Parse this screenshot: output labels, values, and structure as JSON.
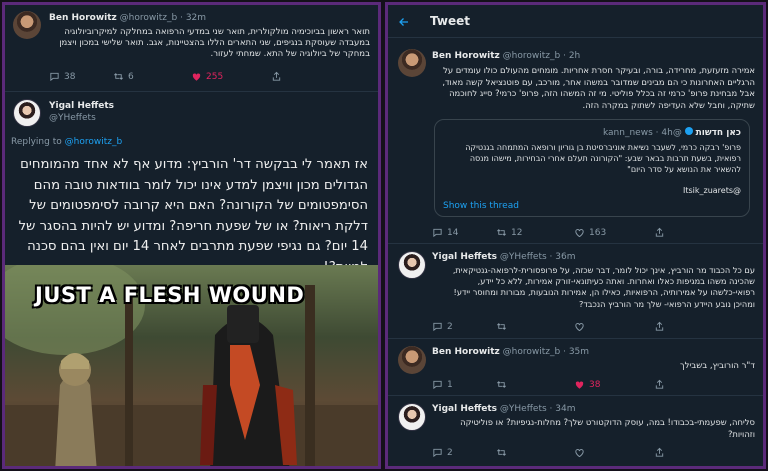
{
  "left": {
    "tweet1": {
      "name": "Ben Horowitz",
      "handle": "@horowitz_b",
      "time": "32m",
      "text": "תואר ראשון בביוכימיה מולקולרית, תואר שני במדעי הרפואה במחלקה למיקרוביולוגיה במעבדה שעוסקת בנגיפים, שני התארים הללו בהצטיינות, אגב. תואר שלישי במכון ויצמן במחקר של ביולוגיה של התא. שמחתי לעזור.",
      "replies": "38",
      "retweets": "6",
      "likes": "255"
    },
    "tweet2": {
      "name": "Yigal Heffets",
      "handle": "@YHeffets",
      "replying_prefix": "Replying to",
      "replying_to": "@horowitz_b",
      "text": "אז תאמר לי בבקשה דר' הורביץ: מדוע אף לא אחד מהמומחים הגדולים מכון וויצמן למדע אינו יכול לומר בוודאות טובה מהם הסימפטומים של הקורונה? האם היא קרובה לסימפטומים של דלקת ריאות? או של שפעת חריפה? ומדוע יש להיות בהסגר של 14 יום? גם נגיפי שפעת מתרבים לאחר 14 יום ואין בהם סכנה למוות?!"
    },
    "meme_caption": "JUST A FLESH WOUND"
  },
  "right": {
    "header_title": "Tweet",
    "main": {
      "name": "Ben Horowitz",
      "handle": "@horowitz_b",
      "time": "2h",
      "text": "אמירה מזעזעת, מחרידה, בורה, ובעיקר חסרת אחריות. מומחים מהעולם כולו עומדים על הרגליים האחרונות כי הם מבינים שמדובר במשהו אחר, מורכב, עם פוטנציאל קשה מאוד, אבל מבחינת פרופ' כרמי זה בכלל פוליטי. מי זה המשהו הזה, פרופ' כרמי? סייג לחוכמה שתיקה, וחבל שלא העדיפה לשתוק במקרה הזה.",
      "quote": {
        "name": "כאן חדשות",
        "handle": "@kann_news",
        "time": "4h",
        "text": "פרופ' רבקה כרמי, לשעבר נשיאת אוניברסיטת בן גוריון ורופאה המתמחה בגנטיקה רפואית, בשעת תרבות בבאר שבע: \"הקורונה תעלם אחרי הבחירות, מישהו מנסה להשאיר את הנושא על סדר היום\"",
        "credit": "@Itsik_zuarets",
        "show_thread": "Show this thread"
      },
      "replies": "14",
      "retweets": "12",
      "likes": "163"
    },
    "reply1": {
      "name": "Yigal Heffets",
      "handle": "@YHeffets",
      "time": "36m",
      "text": "עם כל הכבוד מר הורביץ, אינך יכול לומר, דבר שכזה, על פרופסורית-לרפואה-גנטיקאית, שהכינה משהו במגיפות כאלו ואחרות. ואתה כעיתונאי-זורק אמירות, ללא כל יידע, רפואי-כלשהו על אמירותיה, הרפואיות, כאילו הן, אמירות הנובעות, מבורות ומחוסר יידע! ומהיכן נובע היידע הרפואי- שלך מר הורביץ הנכבד?",
      "replies": "2",
      "retweets": "",
      "likes": ""
    },
    "reply2": {
      "name": "Ben Horowitz",
      "handle": "@horowitz_b",
      "time": "35m",
      "text": "ד\"ר הורוביץ, בשבילך",
      "replies": "1",
      "retweets": "",
      "likes": "38"
    },
    "reply3": {
      "name": "Yigal Heffets",
      "handle": "@YHeffets",
      "time": "34m",
      "text": "סליחה, שפעמתי-בכבודו! במה, עוסק הדוקטורט שלך? מחלות-נגיפיות? או פוליטיקה וזהויות?",
      "replies": "2",
      "retweets": "",
      "likes": ""
    }
  },
  "colors": {
    "accent": "#1da1f2",
    "like": "#e0245e",
    "panel_bg": "#15202b",
    "frame": "#5b2a7a"
  }
}
